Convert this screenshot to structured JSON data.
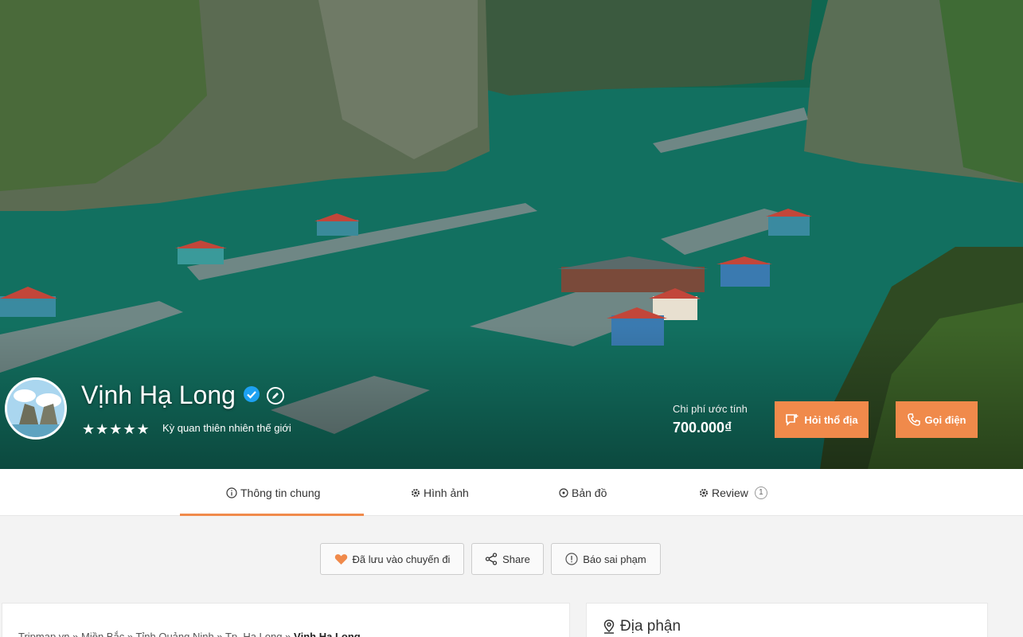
{
  "place": {
    "name": "Vịnh Hạ Long",
    "stars": "★★★★★",
    "subtitle": "Kỳ quan thiên nhiên thế giới",
    "cost_label": "Chi phí ước tính",
    "cost_value": "700.000₫"
  },
  "buttons": {
    "ask_local": "Hỏi thổ địa",
    "call": "Gọi điện"
  },
  "tabs": [
    {
      "label": "Thông tin chung",
      "icon": "info-icon"
    },
    {
      "label": "Hình ảnh",
      "icon": "gear-icon"
    },
    {
      "label": "Bản đồ",
      "icon": "target-icon"
    },
    {
      "label": "Review",
      "icon": "gear-icon",
      "count": "1"
    }
  ],
  "actions": {
    "save": "Đã lưu vào chuyến đi",
    "share": "Share",
    "report": "Báo sai phạm"
  },
  "breadcrumb": {
    "items": [
      "Tripmap.vn",
      "Miền Bắc",
      "Tỉnh Quảng Ninh",
      "Tp. Hạ Long"
    ],
    "separator": " » ",
    "current": "Vịnh Hạ Long"
  },
  "region": {
    "title": "Địa phận"
  },
  "colors": {
    "accent": "#f08a4b",
    "verified": "#1da1f2"
  }
}
